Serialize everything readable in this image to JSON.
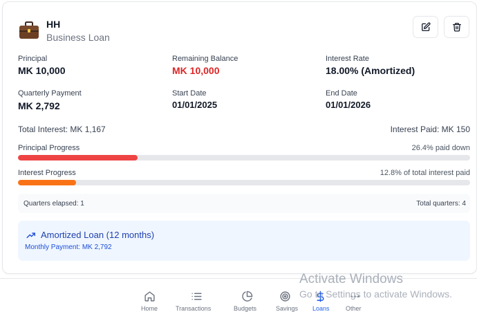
{
  "loan": {
    "name": "HH",
    "type": "Business Loan",
    "icon": "briefcase-icon"
  },
  "actions": {
    "edit_icon": "edit-icon",
    "delete_icon": "trash-icon"
  },
  "details": {
    "principal_label": "Principal",
    "principal_value": "MK 10,000",
    "remaining_label": "Remaining Balance",
    "remaining_value": "MK 10,000",
    "rate_label": "Interest Rate",
    "rate_value": "18.00% (Amortized)",
    "quarterly_label": "Quarterly Payment",
    "quarterly_value": "MK 2,792",
    "start_label": "Start Date",
    "start_value": "01/01/2025",
    "end_label": "End Date",
    "end_value": "01/01/2026"
  },
  "totals": {
    "total_interest": "Total Interest: MK 1,167",
    "interest_paid": "Interest Paid: MK 150"
  },
  "progress": {
    "principal_label": "Principal Progress",
    "principal_text": "26.4% paid down",
    "principal_fraction": 0.264,
    "principal_color": "#ef4444",
    "interest_label": "Interest Progress",
    "interest_text": "12.8% of total interest paid",
    "interest_fraction": 0.128,
    "interest_color": "#f97316"
  },
  "quarters": {
    "elapsed": "Quarters elapsed: 1",
    "total": "Total quarters: 4"
  },
  "amortized": {
    "icon": "trending-up-icon",
    "title": "Amortized Loan (12 months)",
    "monthly": "Monthly Payment: MK 2,792"
  },
  "nav": {
    "items": [
      {
        "icon": "home-icon",
        "label": "Home"
      },
      {
        "icon": "list-icon",
        "label": "Transactions"
      },
      {
        "icon": "pie-chart-icon",
        "label": "Budgets"
      },
      {
        "icon": "target-icon",
        "label": "Savings"
      },
      {
        "icon": "dollar-icon",
        "label": "Loans"
      },
      {
        "icon": "more-icon",
        "label": "Other"
      }
    ]
  },
  "watermark": {
    "line1": "Activate Windows",
    "line2": "Go to Settings to activate Windows."
  }
}
